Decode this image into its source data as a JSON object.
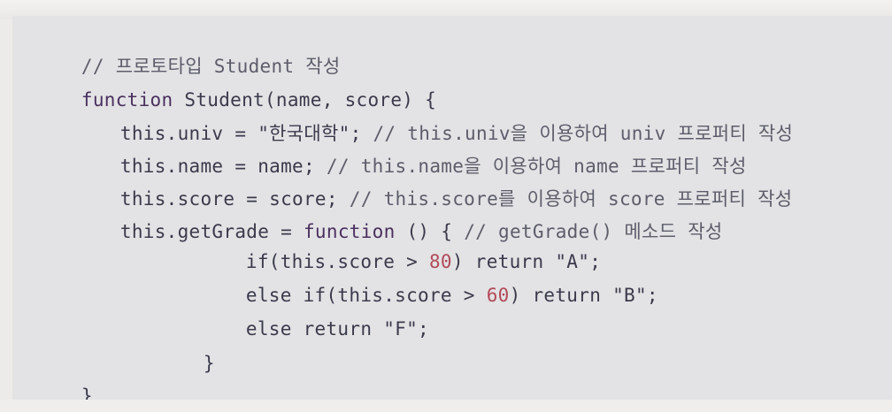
{
  "code": {
    "line1": {
      "comment": "// 프로토타입 Student 작성"
    },
    "line2": {
      "keyword": "function",
      "text": " Student(name, score) {"
    },
    "line3": {
      "code": "this.univ = \"한국대학\";",
      "comment": " // this.univ을 이용하여 univ 프로퍼티 작성"
    },
    "line4": {
      "code": "this.name = name;",
      "comment": " // this.name을 이용하여 name 프로퍼티 작성"
    },
    "line5": {
      "code": "this.score = score;",
      "comment": " // this.score를 이용하여 score 프로퍼티 작성"
    },
    "line6": {
      "code_a": "this.getGrade = ",
      "keyword": "function",
      "code_b": " () {",
      "comment": " // getGrade() 메소드 작성"
    },
    "line7": {
      "code_a": "if(this.score > ",
      "number": "80",
      "code_b": ") return \"A\";"
    },
    "line8": {
      "code_a": "else if(this.score > ",
      "number": "60",
      "code_b": ") return \"B\";"
    },
    "line9": {
      "code": "else return \"F\";"
    },
    "line10": {
      "code": "}"
    },
    "line11": {
      "code": "}"
    }
  },
  "colors": {
    "background": "#e3e3e5",
    "text": "#3d3b4a",
    "number": "#b24a59"
  }
}
